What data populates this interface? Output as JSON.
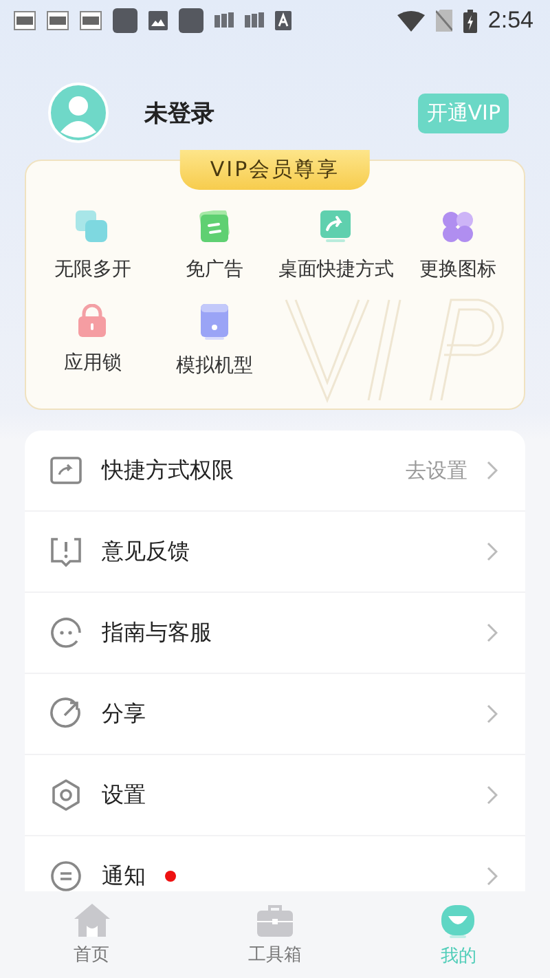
{
  "status_bar": {
    "notifications": [
      {
        "kind": "news"
      },
      {
        "kind": "news"
      },
      {
        "kind": "news"
      },
      {
        "kind": "app"
      },
      {
        "kind": "image"
      },
      {
        "kind": "app"
      },
      {
        "kind": "cards"
      },
      {
        "kind": "cards"
      },
      {
        "kind": "text"
      }
    ],
    "time": "2:54"
  },
  "profile": {
    "name": "未登录",
    "vip_button": "开通VIP"
  },
  "vip_card": {
    "title": "VIP会员尊享",
    "features": [
      {
        "kind": "multi",
        "label": "无限多开"
      },
      {
        "kind": "noad",
        "label": "免广告"
      },
      {
        "kind": "shortcut",
        "label": "桌面快捷方式"
      },
      {
        "kind": "icons",
        "label": "更换图标"
      },
      {
        "kind": "lock",
        "label": "应用锁"
      },
      {
        "kind": "device",
        "label": "模拟机型"
      }
    ]
  },
  "menu": [
    {
      "kind": "shortcut",
      "label": "快捷方式权限",
      "value": "去设置",
      "badge": false
    },
    {
      "kind": "feedback",
      "label": "意见反馈",
      "badge": false
    },
    {
      "kind": "guide",
      "label": "指南与客服",
      "badge": false
    },
    {
      "kind": "share",
      "label": "分享",
      "badge": false
    },
    {
      "kind": "settings",
      "label": "设置",
      "badge": false
    },
    {
      "kind": "notice",
      "label": "通知",
      "badge": true
    }
  ],
  "tab_bar": [
    {
      "kind": "home",
      "label": "首页",
      "selected": false
    },
    {
      "kind": "toolbox",
      "label": "工具箱",
      "selected": false
    },
    {
      "kind": "mine",
      "label": "我的",
      "selected": true
    }
  ]
}
